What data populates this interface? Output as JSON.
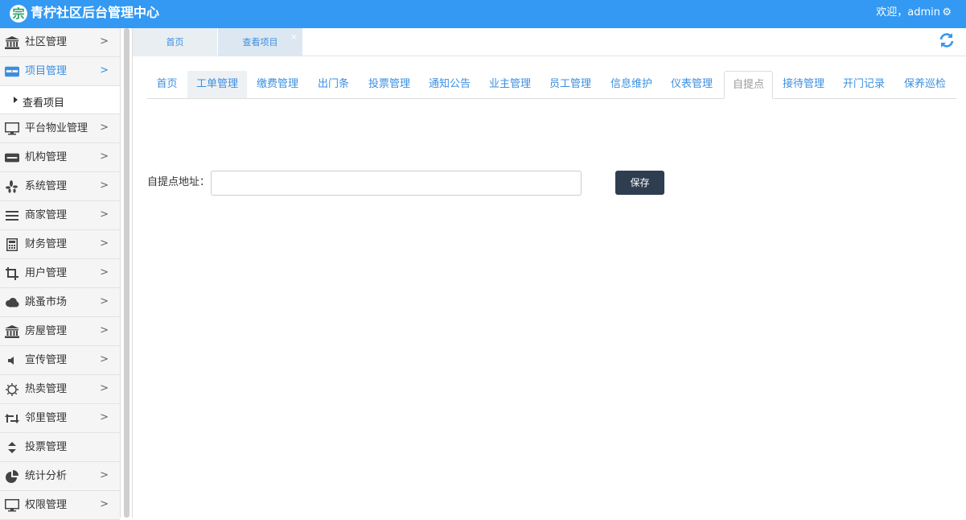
{
  "header": {
    "logo_glyph": "宗",
    "title": "青柠社区后台管理中心",
    "welcome": "欢迎，admin",
    "settings_glyph": "⚙"
  },
  "sidebar": {
    "items": [
      {
        "label": "社区管理",
        "icon": "bank-icon"
      },
      {
        "label": "项目管理",
        "icon": "discover-card-icon"
      },
      {
        "label": "平台物业管理",
        "icon": "desktop-icon"
      },
      {
        "label": "机构管理",
        "icon": "stripe-icon"
      },
      {
        "label": "系统管理",
        "icon": "yelp-icon"
      },
      {
        "label": "商家管理",
        "icon": "bars-icon"
      },
      {
        "label": "财务管理",
        "icon": "calculator-icon"
      },
      {
        "label": "用户管理",
        "icon": "crop-icon"
      },
      {
        "label": "跳蚤市场",
        "icon": "cloud-icon"
      },
      {
        "label": "房屋管理",
        "icon": "bank-icon"
      },
      {
        "label": "宣传管理",
        "icon": "volume-icon"
      },
      {
        "label": "热卖管理",
        "icon": "sun-icon"
      },
      {
        "label": "邻里管理",
        "icon": "retweet-icon"
      },
      {
        "label": "投票管理",
        "icon": "sort-icon"
      },
      {
        "label": "统计分析",
        "icon": "pie-chart-icon"
      },
      {
        "label": "权限管理",
        "icon": "desktop-icon"
      }
    ],
    "subitem": "查看项目",
    "chevron": ">"
  },
  "page_tabs": [
    {
      "label": "首页"
    },
    {
      "label": "查看项目",
      "close": "×"
    }
  ],
  "sub_tabs": [
    "首页",
    "工单管理",
    "缴费管理",
    "出门条",
    "投票管理",
    "通知公告",
    "业主管理",
    "员工管理",
    "信息维护",
    "仪表管理",
    "自提点",
    "接待管理",
    "开门记录",
    "保养巡检"
  ],
  "form": {
    "label": "自提点地址：",
    "value": "",
    "placeholder": "",
    "save": "保存"
  },
  "colors": {
    "header": "#3399f3",
    "link": "#3b8fe0",
    "button": "#2e3e50"
  }
}
